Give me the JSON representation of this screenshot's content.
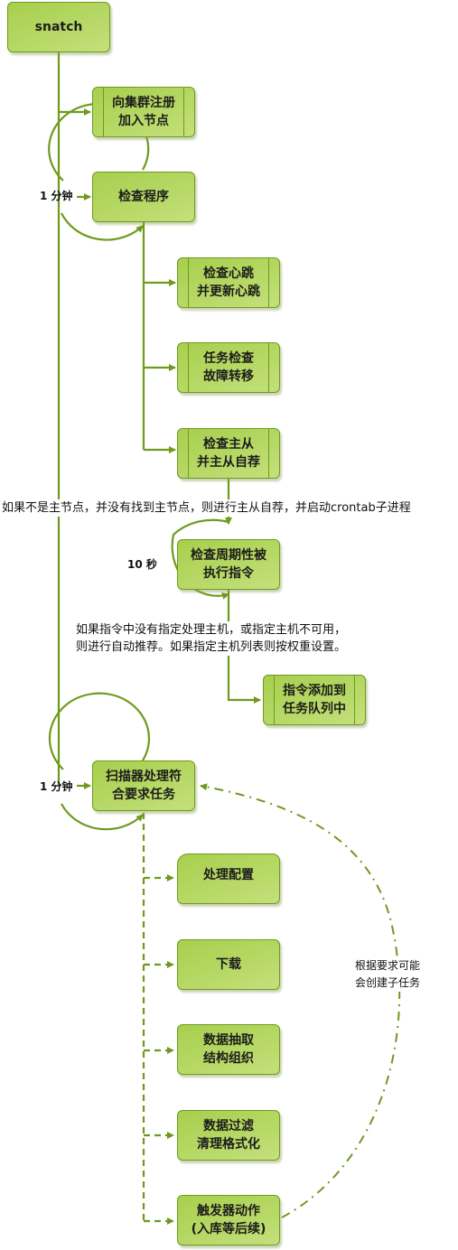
{
  "diagram": {
    "root": {
      "label": "snatch"
    },
    "register": {
      "label": "向集群注册\n加入节点"
    },
    "check_program": {
      "label": "检查程序",
      "interval": "1 分钟"
    },
    "heartbeat": {
      "label": "检查心跳\n并更新心跳"
    },
    "failover": {
      "label": "任务检查\n故障转移"
    },
    "master_slave": {
      "label": "检查主从\n并主从自荐"
    },
    "master_note": "如果不是主节点，并没有找到主节点，则进行主从自荐，并启动crontab子进程",
    "periodic": {
      "label": "检查周期性被\n执行指令",
      "interval": "10 秒"
    },
    "host_note": "如果指令中没有指定处理主机，或指定主机不可用，\n则进行自动推荐。如果指定主机列表则按权重设置。",
    "enqueue": {
      "label": "指令添加到\n任务队列中"
    },
    "scanner": {
      "label": "扫描器处理符\n合要求任务",
      "interval": "1 分钟"
    },
    "process_config": {
      "label": "处理配置"
    },
    "download": {
      "label": "下载"
    },
    "extract": {
      "label": "数据抽取\n结构组织"
    },
    "filter": {
      "label": "数据过滤\n清理格式化"
    },
    "trigger": {
      "label": "触发器动作\n(入库等后续)"
    },
    "subtask_note": "根据要求可能\n会创建子任务"
  },
  "colors": {
    "line": "#6f9a1d",
    "fill": "#b6d865"
  }
}
